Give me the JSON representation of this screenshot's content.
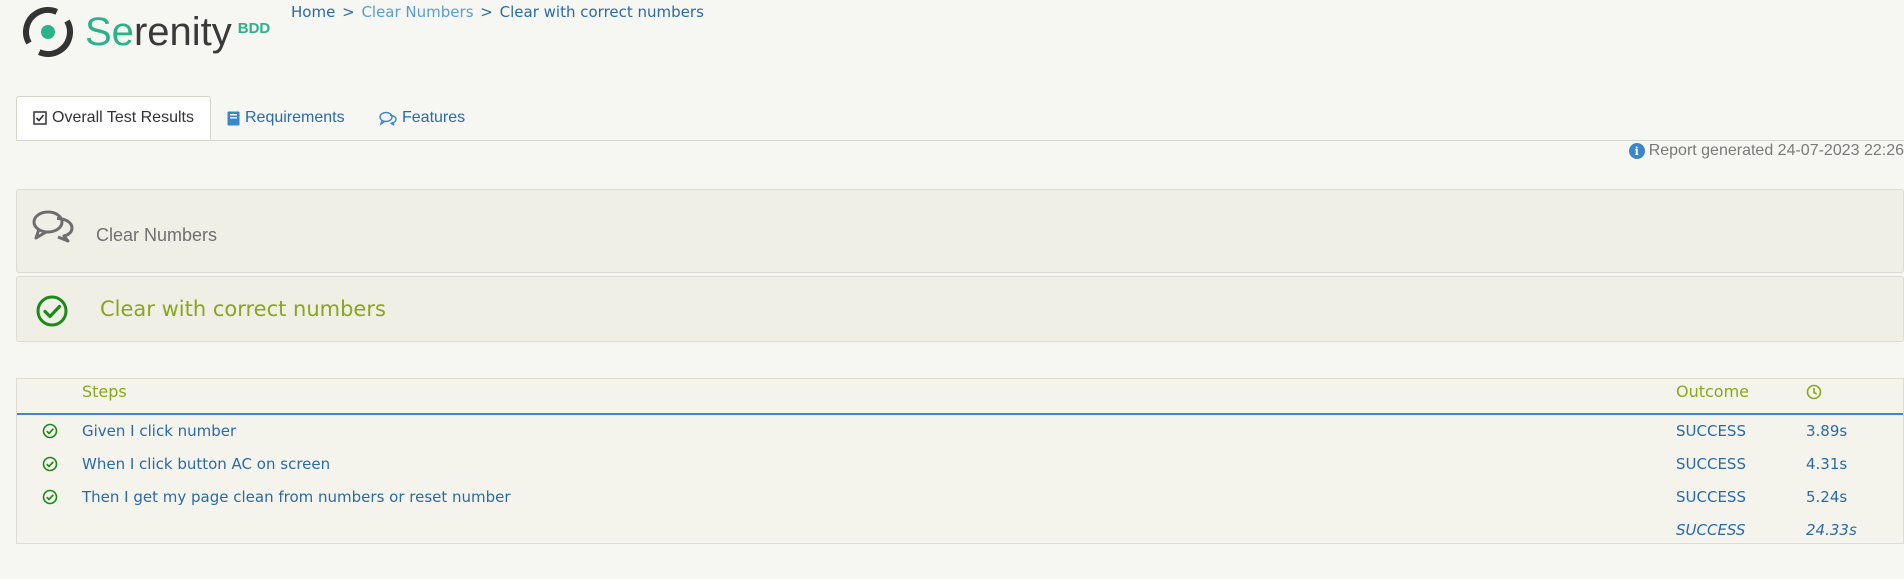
{
  "logo": {
    "text_accent": "Se",
    "text_rest": "renity",
    "sub": "BDD"
  },
  "breadcrumb": {
    "home": "Home",
    "sep1": ">",
    "feature": "Clear Numbers",
    "sep2": ">",
    "scenario": "Clear with correct numbers"
  },
  "tabs": [
    {
      "label": "Overall Test Results",
      "icon": "checkbox-icon",
      "active": true
    },
    {
      "label": "Requirements",
      "icon": "book-icon",
      "active": false
    },
    {
      "label": "Features",
      "icon": "comments-icon",
      "active": false
    }
  ],
  "report": {
    "text": "Report generated 24-07-2023 22:26",
    "icon": "info-icon"
  },
  "feature": {
    "title": "Clear Numbers",
    "icon": "comments-icon"
  },
  "scenario": {
    "title": "Clear with correct numbers",
    "icon": "check-circle-icon"
  },
  "steps_table": {
    "headers": {
      "steps": "Steps",
      "outcome": "Outcome",
      "duration_icon": "clock-icon"
    },
    "rows": [
      {
        "text": "Given I click number",
        "outcome": "SUCCESS",
        "duration": "3.89s"
      },
      {
        "text": "When I click button AC on screen",
        "outcome": "SUCCESS",
        "duration": "4.31s"
      },
      {
        "text": "Then I get my page clean from numbers or reset number",
        "outcome": "SUCCESS",
        "duration": "5.24s"
      }
    ],
    "total": {
      "outcome": "SUCCESS",
      "duration": "24.33s"
    }
  },
  "colors": {
    "brand": "#2bb28a",
    "link": "#2a6aa6",
    "success": "#8aa51f",
    "check": "#1a8a1a",
    "background": "#f6f6f2"
  }
}
